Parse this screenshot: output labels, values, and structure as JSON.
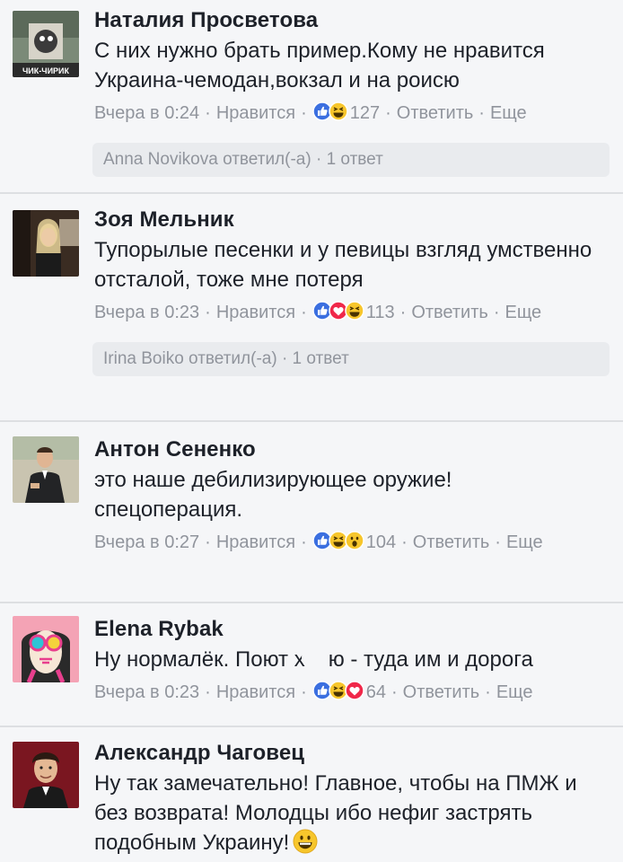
{
  "comments": [
    {
      "author": "Наталия Просветова",
      "avatar_label": "ЧИК-ЧИРИК",
      "text": "С них нужно брать пример.Кому не нравится Украина-чемодан,вокзал и на роисю",
      "time": "Вчера в 0:24",
      "like_label": "Нравится",
      "reactions": [
        "like",
        "haha"
      ],
      "reaction_count": "127",
      "reply_label": "Ответить",
      "more_label": "Еще",
      "replies": "Anna Novikova ответил(-а) · 1 ответ"
    },
    {
      "author": "Зоя Мельник",
      "text": "Тупорылые песенки и у певицы взгляд умственно отсталой, тоже мне потеря",
      "time": "Вчера в 0:23",
      "like_label": "Нравится",
      "reactions": [
        "like",
        "love",
        "haha"
      ],
      "reaction_count": "113",
      "reply_label": "Ответить",
      "more_label": "Еще",
      "replies": "Irina Boiko ответил(-а) · 1 ответ"
    },
    {
      "author": "Антон Сененко",
      "text": "это наше дебилизирующее оружие! спецоперация.",
      "time": "Вчера в 0:27",
      "like_label": "Нравится",
      "reactions": [
        "like",
        "haha",
        "wow"
      ],
      "reaction_count": "104",
      "reply_label": "Ответить",
      "more_label": "Еще"
    },
    {
      "author": "Elena Rybak",
      "text_before": "Ну нормалёк. Поют х",
      "text_after": "ю - туда им и дорога",
      "time": "Вчера в 0:23",
      "like_label": "Нравится",
      "reactions": [
        "like",
        "haha",
        "love"
      ],
      "reaction_count": "64",
      "reply_label": "Ответить",
      "more_label": "Еще"
    },
    {
      "author": "Александр Чаговец",
      "text": "Ну так замечательно! Главное, чтобы на ПМЖ и без возврата! Молодцы ибо нефиг застрять подобным Украину!",
      "emoji": "grinning-face"
    }
  ],
  "colors": {
    "background": "#f5f6f8",
    "meta": "#90949c",
    "divider": "#dddfe2",
    "like_blue": "#3b6fe0",
    "love_red": "#f0284a",
    "haha_yellow": "#f7c62c"
  }
}
